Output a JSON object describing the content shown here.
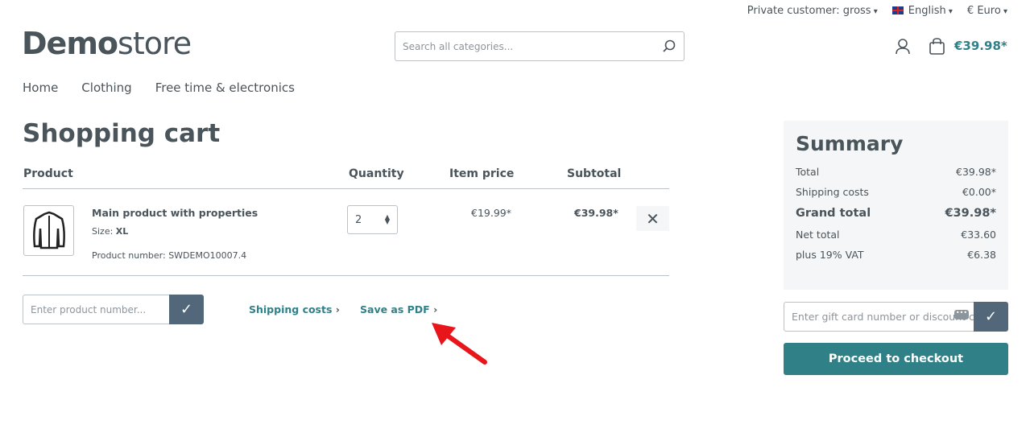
{
  "topbar": {
    "customer": "Private customer: gross",
    "language": "English",
    "currency": "€ Euro"
  },
  "logo": {
    "bold": "Demo",
    "light": "store"
  },
  "search": {
    "placeholder": "Search all categories..."
  },
  "header": {
    "cart_total": "€39.98*"
  },
  "nav": [
    "Home",
    "Clothing",
    "Free time & electronics"
  ],
  "cart": {
    "title": "Shopping cart",
    "columns": {
      "product": "Product",
      "quantity": "Quantity",
      "item_price": "Item price",
      "subtotal": "Subtotal"
    },
    "items": [
      {
        "name": "Main product with properties",
        "size_label": "Size:",
        "size": "XL",
        "number": "Product number: SWDEMO10007.4",
        "quantity": "2",
        "item_price": "€19.99*",
        "subtotal": "€39.98*"
      }
    ],
    "product_number_placeholder": "Enter product number...",
    "shipping_link": "Shipping costs",
    "pdf_link": "Save as PDF"
  },
  "summary": {
    "title": "Summary",
    "rows": [
      {
        "label": "Total",
        "value": "€39.98*"
      },
      {
        "label": "Shipping costs",
        "value": "€0.00*"
      },
      {
        "label": "Grand total",
        "value": "€39.98*"
      },
      {
        "label": "Net total",
        "value": "€33.60"
      },
      {
        "label": "plus 19% VAT",
        "value": "€6.38"
      }
    ],
    "gift_placeholder": "Enter gift card number or discount code...",
    "checkout": "Proceed to checkout"
  },
  "colors": {
    "accent": "#2f8087",
    "button": "#52687a",
    "annotation": "#e8151b"
  }
}
